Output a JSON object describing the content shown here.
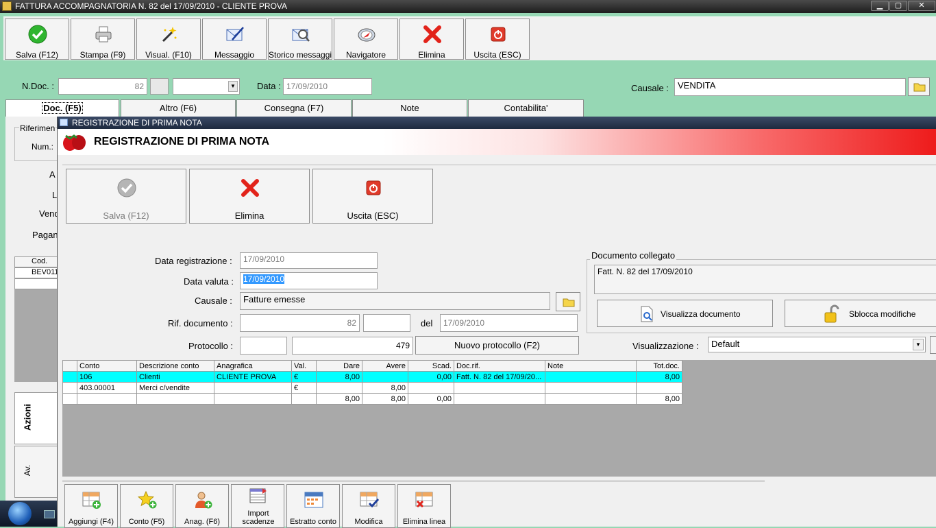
{
  "window": {
    "title": "FATTURA ACCOMPAGNATORIA N. 82  del 17/09/2010 - CLIENTE PROVA",
    "min": "▁",
    "max": "▢",
    "close": "✕"
  },
  "toolbar": [
    {
      "label": "Salva (F12)",
      "icon": "check-icon"
    },
    {
      "label": "Stampa (F9)",
      "icon": "printer-icon"
    },
    {
      "label": "Visual. (F10)",
      "icon": "magic-wand-icon"
    },
    {
      "label": "Messaggio",
      "icon": "message-icon"
    },
    {
      "label": "Storico messaggi",
      "icon": "message-history-icon"
    },
    {
      "label": "Navigatore",
      "icon": "compass-icon"
    },
    {
      "label": "Elimina",
      "icon": "delete-x-icon"
    },
    {
      "label": "Uscita (ESC)",
      "icon": "exit-icon"
    }
  ],
  "header": {
    "ndoc_label": "N.Doc. :",
    "ndoc_value": "82",
    "data_label": "Data :",
    "data_value": "17/09/2010",
    "causale_label": "Causale :",
    "causale_value": "VENDITA"
  },
  "tabs": [
    "Doc. (F5)",
    "Altro (F6)",
    "Consegna (F7)",
    "Note",
    "Contabilita'"
  ],
  "behind": {
    "riferim": "Riferimen",
    "num": "Num.:",
    "a": "A",
    "l": "L",
    "vend": "Vend",
    "pagam": "Pagan",
    "col_cod": "Cod.",
    "row_cod": "BEV011",
    "vtab1": "Azioni",
    "vtab2": "Av."
  },
  "dialog": {
    "title": "REGISTRAZIONE DI PRIMA NOTA",
    "banner_title": "REGISTRAZIONE DI PRIMA NOTA",
    "buttons": [
      {
        "label": "Salva (F12)",
        "icon": "check-disabled-icon"
      },
      {
        "label": "Elimina",
        "icon": "delete-x-icon"
      },
      {
        "label": "Uscita (ESC)",
        "icon": "exit-icon"
      }
    ],
    "form": {
      "data_reg_label": "Data registrazione :",
      "data_reg_value": "17/09/2010",
      "data_val_label": "Data valuta :",
      "data_val_value": "17/09/2010",
      "causale_label": "Causale :",
      "causale_value": "Fatture emesse",
      "rif_label": "Rif. documento :",
      "rif_value": "82",
      "del_label": "del",
      "del_value": "17/09/2010",
      "protocollo_label": "Protocollo :",
      "protocollo_value": "479",
      "nuovo_protocollo": "Nuovo protocollo (F2)",
      "visualizzazione_label": "Visualizzazione :",
      "visualizzazione_value": "Default"
    },
    "doc_collegato": {
      "legend": "Documento collegato",
      "text": "Fatt. N. 82 del 17/09/2010",
      "btn_visualizza": "Visualizza documento",
      "btn_sblocca": "Sblocca modifiche"
    },
    "grid": {
      "columns": [
        "Conto",
        "Descrizione conto",
        "Anagrafica",
        "Val.",
        "Dare",
        "Avere",
        "Scad.",
        "Doc.rif.",
        "Note",
        "Tot.doc."
      ],
      "rows": [
        [
          "106",
          "Clienti",
          "CLIENTE PROVA",
          "€",
          "8,00",
          "",
          "0,00",
          "Fatt. N. 82 del 17/09/20...",
          "",
          "8,00"
        ],
        [
          "403.00001",
          "Merci c/vendite",
          "",
          "€",
          "",
          "8,00",
          "",
          "",
          "",
          ""
        ]
      ],
      "totals": [
        "",
        "",
        "",
        "",
        "8,00",
        "8,00",
        "0,00",
        "",
        "",
        "8,00"
      ]
    },
    "bottom": [
      {
        "label": "Aggiungi (F4)",
        "icon": "add-row-icon"
      },
      {
        "label": "Conto (F5)",
        "icon": "star-add-icon"
      },
      {
        "label": "Anag. (F6)",
        "icon": "person-add-icon"
      },
      {
        "label": "Import scadenze",
        "icon": "import-icon"
      },
      {
        "label": "Estratto conto",
        "icon": "calendar-icon"
      },
      {
        "label": "Modifica",
        "icon": "edit-grid-icon"
      },
      {
        "label": "Elimina linea",
        "icon": "delete-row-icon"
      }
    ]
  }
}
